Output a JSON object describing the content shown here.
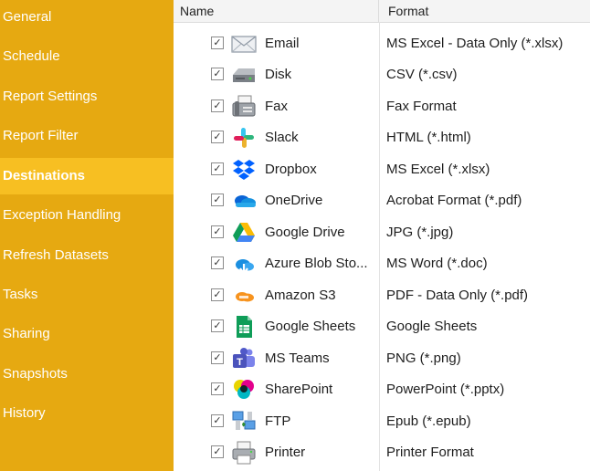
{
  "sidebar": {
    "items": [
      {
        "label": "General"
      },
      {
        "label": "Schedule"
      },
      {
        "label": "Report Settings"
      },
      {
        "label": "Report Filter"
      },
      {
        "label": "Destinations",
        "active": true
      },
      {
        "label": "Exception Handling"
      },
      {
        "label": "Refresh Datasets"
      },
      {
        "label": "Tasks"
      },
      {
        "label": "Sharing"
      },
      {
        "label": "Snapshots"
      },
      {
        "label": "History"
      }
    ]
  },
  "grid": {
    "columns": {
      "name": "Name",
      "format": "Format"
    },
    "rows": [
      {
        "checked": true,
        "check": "✓",
        "icon": "email-icon",
        "name": "Email",
        "format": "MS Excel - Data Only (*.xlsx)"
      },
      {
        "checked": true,
        "check": "✓",
        "icon": "disk-icon",
        "name": "Disk",
        "format": "CSV (*.csv)"
      },
      {
        "checked": true,
        "check": "✓",
        "icon": "fax-icon",
        "name": "Fax",
        "format": "Fax Format"
      },
      {
        "checked": true,
        "check": "✓",
        "icon": "slack-icon",
        "name": "Slack",
        "format": "HTML (*.html)"
      },
      {
        "checked": true,
        "check": "✓",
        "icon": "dropbox-icon",
        "name": "Dropbox",
        "format": "MS Excel (*.xlsx)"
      },
      {
        "checked": true,
        "check": "✓",
        "icon": "onedrive-icon",
        "name": "OneDrive",
        "format": "Acrobat Format (*.pdf)"
      },
      {
        "checked": true,
        "check": "✓",
        "icon": "google-drive-icon",
        "name": "Google Drive",
        "format": "JPG (*.jpg)"
      },
      {
        "checked": true,
        "check": "✓",
        "icon": "azure-blob-icon",
        "name": "Azure Blob Sto...",
        "format": "MS Word (*.doc)"
      },
      {
        "checked": true,
        "check": "✓",
        "icon": "amazon-s3-icon",
        "name": "Amazon S3",
        "format": "PDF - Data Only (*.pdf)"
      },
      {
        "checked": true,
        "check": "✓",
        "icon": "google-sheets-icon",
        "name": "Google Sheets",
        "format": "Google Sheets"
      },
      {
        "checked": true,
        "check": "✓",
        "icon": "ms-teams-icon",
        "name": "MS Teams",
        "format": "PNG (*.png)"
      },
      {
        "checked": true,
        "check": "✓",
        "icon": "sharepoint-icon",
        "name": "SharePoint",
        "format": "PowerPoint (*.pptx)"
      },
      {
        "checked": true,
        "check": "✓",
        "icon": "ftp-icon",
        "name": "FTP",
        "format": "Epub (*.epub)"
      },
      {
        "checked": true,
        "check": "✓",
        "icon": "printer-icon",
        "name": "Printer",
        "format": "Printer Format"
      }
    ]
  },
  "colors": {
    "sidebar_bg": "#e6a911",
    "sidebar_active_bg": "#f7bf22",
    "sidebar_text": "#ffffff"
  }
}
